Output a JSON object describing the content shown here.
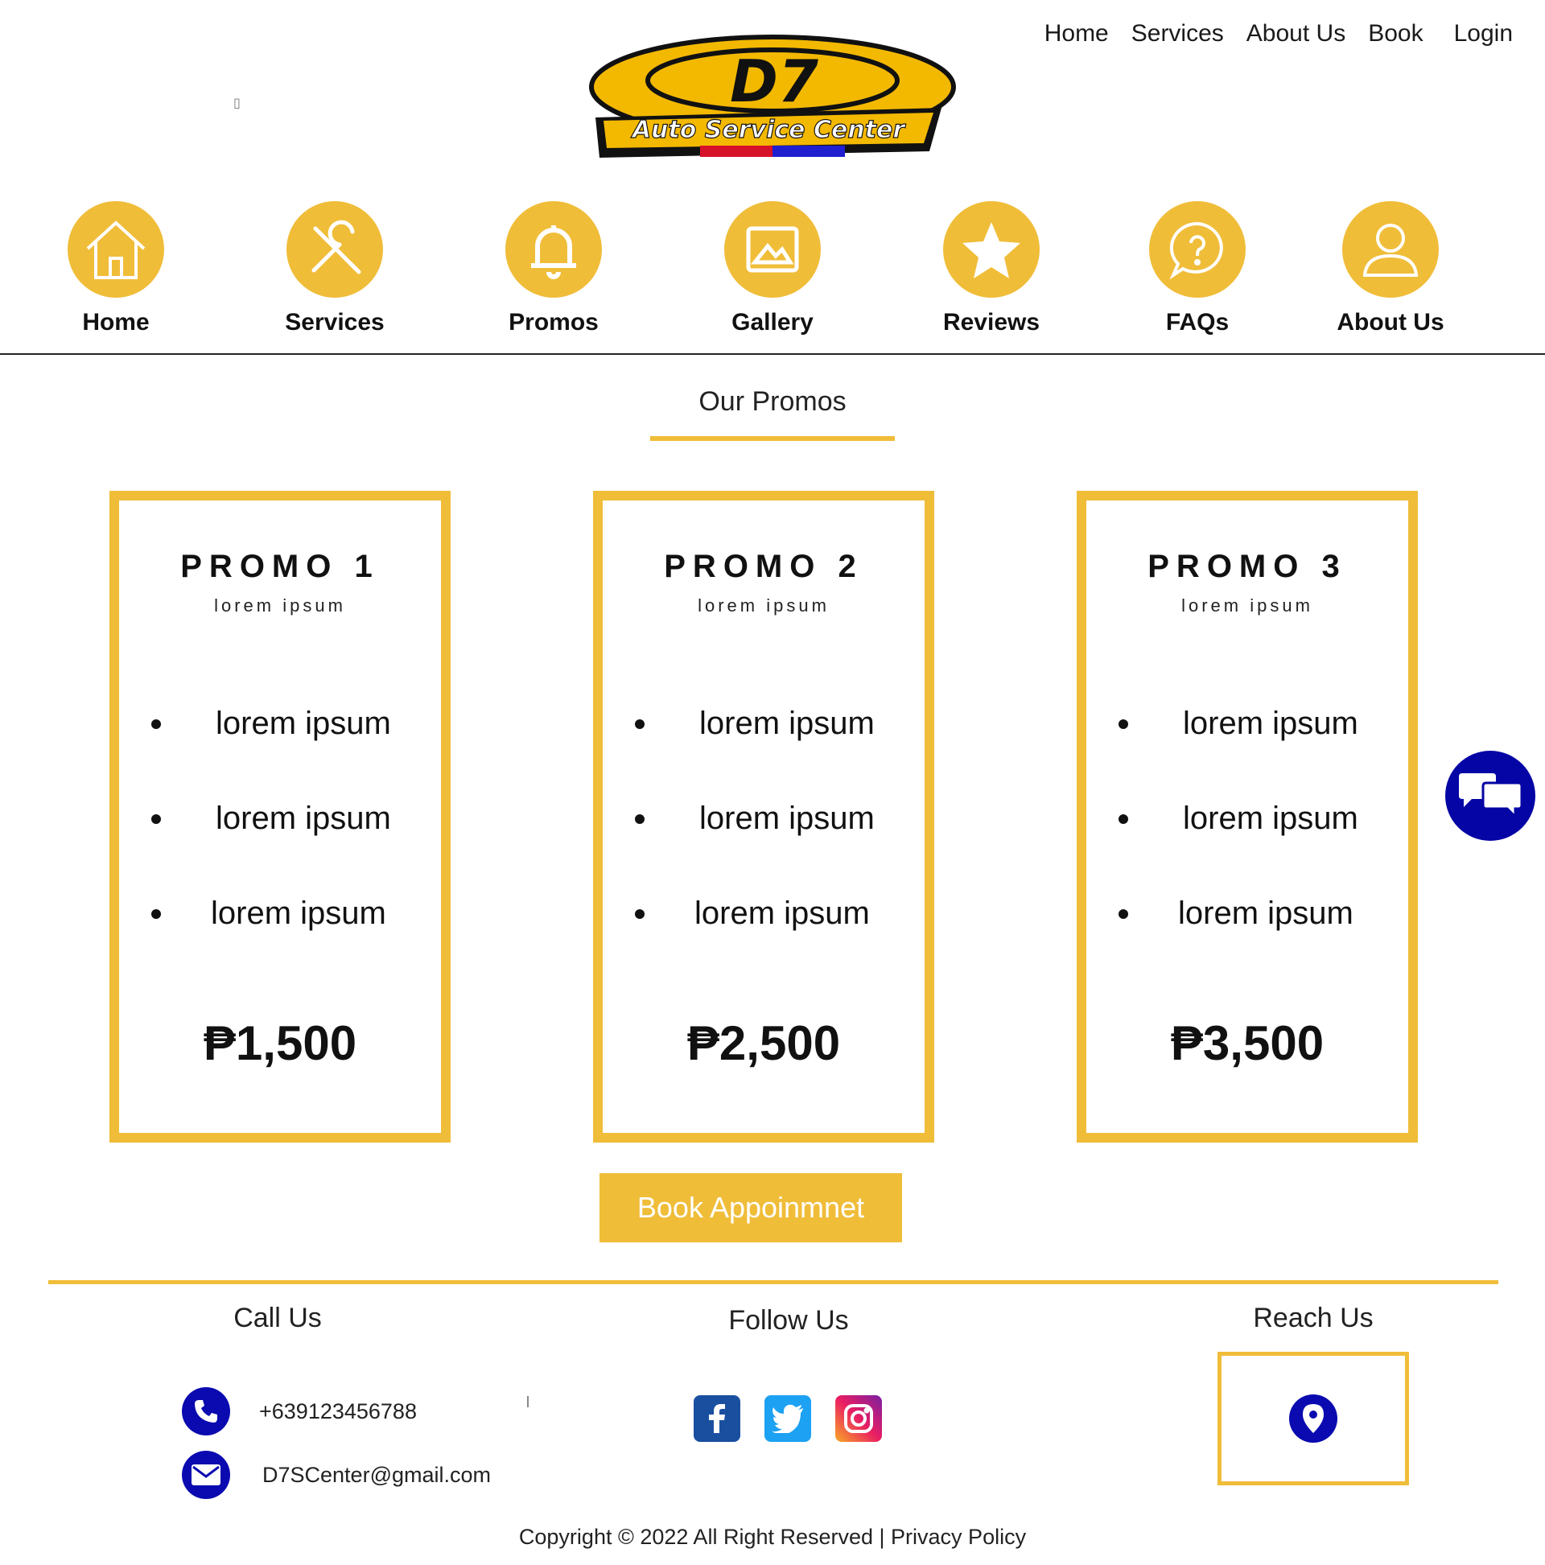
{
  "nav": {
    "items": [
      "Home",
      "Services",
      "About Us",
      "Book",
      "Login"
    ]
  },
  "categories": [
    {
      "label": "Home",
      "icon": "house-icon"
    },
    {
      "label": "Services",
      "icon": "tools-icon"
    },
    {
      "label": "Promos",
      "icon": "bell-icon"
    },
    {
      "label": "Gallery",
      "icon": "image-icon"
    },
    {
      "label": "Reviews",
      "icon": "star-icon"
    },
    {
      "label": "FAQs",
      "icon": "question-bubble-icon"
    },
    {
      "label": "About Us",
      "icon": "user-icon"
    }
  ],
  "logo": {
    "brand": "D7",
    "tagline": "Auto Service Center"
  },
  "section_title": "Our Promos",
  "promos": [
    {
      "title": "PROMO 1",
      "subtitle": "lorem ipsum",
      "items": [
        "lorem ipsum",
        "lorem ipsum",
        "lorem ipsum"
      ],
      "price": "₱1,500"
    },
    {
      "title": "PROMO 2",
      "subtitle": "lorem ipsum",
      "items": [
        "lorem ipsum",
        "lorem ipsum",
        "lorem ipsum"
      ],
      "price": "₱2,500"
    },
    {
      "title": "PROMO 3",
      "subtitle": "lorem ipsum",
      "items": [
        "lorem ipsum",
        "lorem ipsum",
        "lorem ipsum"
      ],
      "price": "₱3,500"
    }
  ],
  "book_button": "Book Appoinmnet",
  "footer": {
    "call_title": "Call Us",
    "phone": "+639123456788",
    "email": "D7SCenter@gmail.com",
    "follow_title": "Follow Us",
    "reach_title": "Reach Us",
    "copyright": "Copyright © 2022 All Right Reserved | Privacy Policy"
  },
  "colors": {
    "accent": "#f0bd39",
    "blue": "#0a0ab0",
    "facebook": "#1a4fa0",
    "twitter": "#1da1f2"
  }
}
